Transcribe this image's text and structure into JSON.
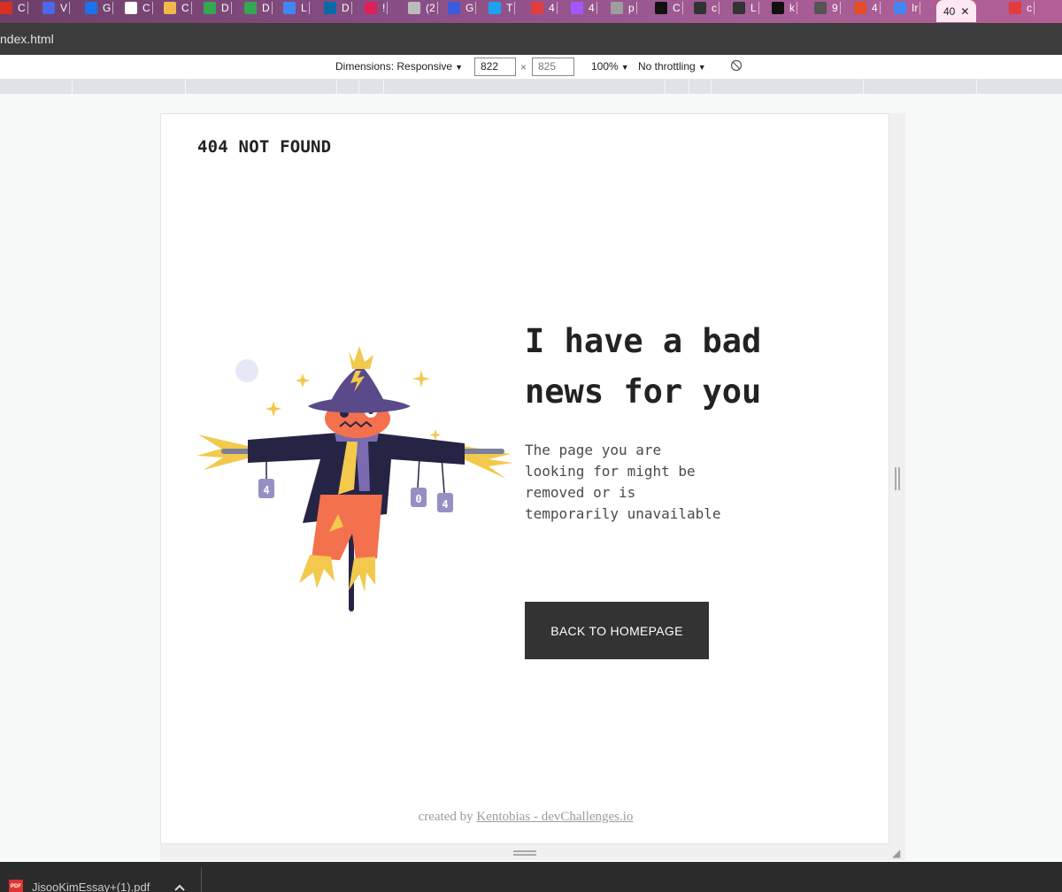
{
  "tabs": [
    {
      "icon": "gmail-icon",
      "label": "C",
      "color": "#d93025"
    },
    {
      "icon": "chromium-icon",
      "label": "V",
      "color": "#4a68e8"
    },
    {
      "icon": "calendar-icon",
      "label": "G",
      "color": "#1a73e8"
    },
    {
      "icon": "doc-icon",
      "label": "C",
      "color": "#ffffff"
    },
    {
      "icon": "avatar-icon",
      "label": "C",
      "color": "#f2b84b"
    },
    {
      "icon": "maps-icon",
      "label": "D",
      "color": "#34a853"
    },
    {
      "icon": "maps-icon",
      "label": "D",
      "color": "#34a853"
    },
    {
      "icon": "drop-icon",
      "label": "L",
      "color": "#4285f4"
    },
    {
      "icon": "dominos-icon",
      "label": "D",
      "color": "#0b6aa8"
    },
    {
      "icon": "slack-icon",
      "label": "!",
      "color": "#e01e5a"
    },
    {
      "icon": "sound-icon",
      "label": "(2",
      "color": "#bbbbbb"
    },
    {
      "icon": "circle-icon",
      "label": "G",
      "color": "#3b5bdb"
    },
    {
      "icon": "twitter-icon",
      "label": "T",
      "color": "#1da1f2"
    },
    {
      "icon": "code-icon",
      "label": "4",
      "color": "#e23c3c"
    },
    {
      "icon": "figma-icon",
      "label": "4",
      "color": "#a259ff"
    },
    {
      "icon": "file-icon",
      "label": "p",
      "color": "#9e9e9e"
    },
    {
      "icon": "dollar-icon",
      "label": "C",
      "color": "#111111"
    },
    {
      "icon": "note-icon",
      "label": "c",
      "color": "#333333"
    },
    {
      "icon": "terminal-icon",
      "label": "L",
      "color": "#333333"
    },
    {
      "icon": "github-icon",
      "label": "k",
      "color": "#111111"
    },
    {
      "icon": "globe-icon",
      "label": "9",
      "color": "#555555"
    },
    {
      "icon": "html5-icon",
      "label": "4",
      "color": "#e34f26"
    },
    {
      "icon": "grid-icon",
      "label": "Ir",
      "color": "#4285f4"
    },
    {
      "icon": "",
      "label": "40",
      "active": true
    },
    {
      "icon": "code-icon",
      "label": "c",
      "color": "#e23c3c"
    }
  ],
  "title_bar": {
    "text": "ndex.html"
  },
  "device_toolbar": {
    "dimensions_label": "Dimensions: Responsive",
    "width": "822",
    "times": "×",
    "height": "825",
    "zoom": "100%",
    "throttle": "No throttling"
  },
  "page": {
    "brand": "404 NOT FOUND",
    "headline": "I have a bad news for you",
    "description": "The page you are looking for might be removed or is temporarily unavailable",
    "cta": "BACK TO HOMEPAGE",
    "credits_prefix": "created by ",
    "credits_author": "Kentobias",
    "credits_sep": " - ",
    "credits_site": "devChallenges.io",
    "scarecrow_can_labels": [
      "4",
      "0",
      "4"
    ]
  },
  "downloads": {
    "file_name": "JisooKimEssay+(1).pdf",
    "file_badge": "PDF"
  }
}
